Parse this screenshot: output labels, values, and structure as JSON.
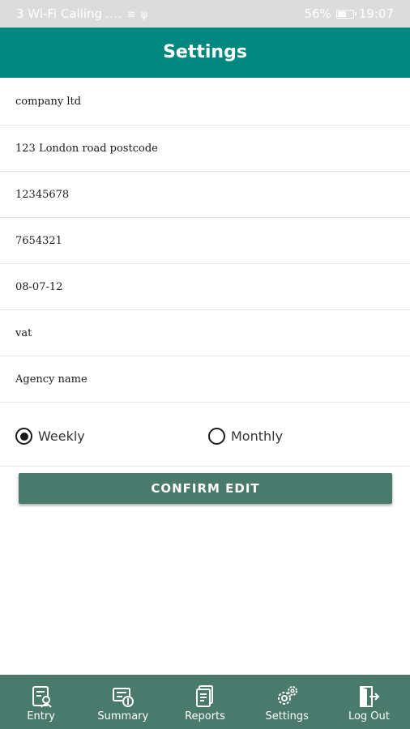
{
  "status_bar": {
    "carrier": "3 Wi-Fi Calling",
    "signal_dots": "....",
    "battery_percent": "56%",
    "time": "19:07",
    "battery_level": 0.56
  },
  "header": {
    "title": "Settings"
  },
  "fields": [
    {
      "value": "company ltd"
    },
    {
      "value": "123 London road postcode"
    },
    {
      "value": "12345678"
    },
    {
      "value": "7654321"
    },
    {
      "value": "08-07-12"
    },
    {
      "value": "vat"
    },
    {
      "value": "Agency name"
    }
  ],
  "frequency": {
    "options": [
      {
        "label": "Weekly",
        "checked": true
      },
      {
        "label": "Monthly",
        "checked": false
      }
    ]
  },
  "confirm_button": {
    "label": "CONFIRM EDIT"
  },
  "bottom_nav": {
    "items": [
      {
        "label": "Entry",
        "icon": "entry-icon"
      },
      {
        "label": "Summary",
        "icon": "summary-icon"
      },
      {
        "label": "Reports",
        "icon": "reports-icon"
      },
      {
        "label": "Settings",
        "icon": "settings-gear-icon"
      },
      {
        "label": "Log Out",
        "icon": "logout-icon"
      }
    ]
  },
  "colors": {
    "app_bar": "#00877f",
    "button": "#4a7a6c",
    "bottom_nav": "#4a7a6c",
    "status_bar": "#dcdcdc"
  }
}
